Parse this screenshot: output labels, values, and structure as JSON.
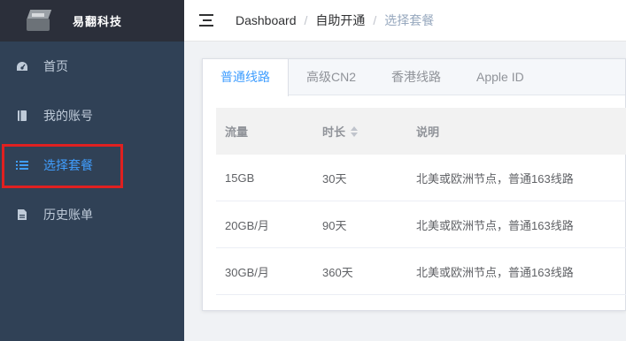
{
  "sidebar": {
    "brand_title": "易翻科技",
    "items": [
      {
        "label": "首页",
        "icon": "dashboard-icon"
      },
      {
        "label": "我的账号",
        "icon": "book-icon"
      },
      {
        "label": "选择套餐",
        "icon": "list-icon",
        "active": true
      },
      {
        "label": "历史账单",
        "icon": "document-icon"
      }
    ]
  },
  "header": {
    "breadcrumb": [
      "Dashboard",
      "自助开通",
      "选择套餐"
    ]
  },
  "tabs": [
    "普通线路",
    "高级CN2",
    "香港线路",
    "Apple ID"
  ],
  "table": {
    "columns": [
      "流量",
      "时长",
      "说明"
    ],
    "rows": [
      [
        "15GB",
        "30天",
        "北美或欧洲节点，普通163线路"
      ],
      [
        "20GB/月",
        "90天",
        "北美或欧洲节点，普通163线路"
      ],
      [
        "30GB/月",
        "360天",
        "北美或欧洲节点，普通163线路"
      ]
    ]
  },
  "colors": {
    "sidebar_bg": "#304156",
    "brand_bg": "#2b2f3a",
    "accent": "#409eff",
    "highlight": "#e02020"
  }
}
